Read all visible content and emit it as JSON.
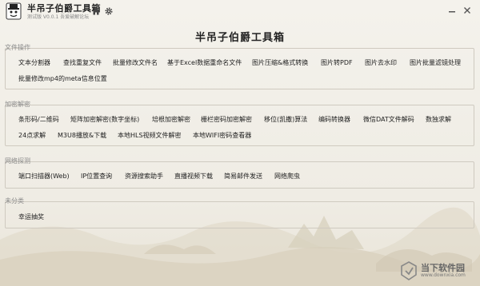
{
  "app": {
    "title": "半吊子伯爵工具箱",
    "subtitle": "测试版 V0.0.1 吾爱破解论坛",
    "main_title": "半吊子伯爵工具箱"
  },
  "titlebar_icons": {
    "home": "home-icon",
    "settings": "gear-icon",
    "minimize": "minimize-icon",
    "close": "close-icon"
  },
  "groups": [
    {
      "title": "文件操作",
      "items": [
        "文本分割器",
        "查找重复文件",
        "批量修改文件名",
        "基于Excel数据重命名文件",
        "图片压缩&格式转换",
        "图片转PDF",
        "图片去水印",
        "图片批量滤镜处理",
        "批量修改mp4的meta信息位置"
      ]
    },
    {
      "title": "加密解密",
      "items": [
        "条形码/二维码",
        "矩阵加密解密(数字坐标)",
        "培根加密解密",
        "栅栏密码加密解密",
        "移位(凯撒)算法",
        "编码转换器",
        "微信DAT文件解码",
        "数独求解",
        "24点求解",
        "M3U8播放&下载",
        "本地HLS视频文件解密",
        "本地WIFI密码查看器"
      ]
    },
    {
      "title": "网络探测",
      "items": [
        "端口扫描器(Web)",
        "IP位置查询",
        "资源搜索助手",
        "直播视频下载",
        "简易邮件发送",
        "网络爬虫"
      ]
    },
    {
      "title": "未分类",
      "items": [
        "幸运抽奖"
      ]
    }
  ],
  "watermark": {
    "text": "当下软件园",
    "url": "www.downxia.com"
  },
  "colors": {
    "background": "#f2f0ea",
    "text": "#222222",
    "group_title": "#8a8a8a",
    "border": "#cfcac0"
  }
}
